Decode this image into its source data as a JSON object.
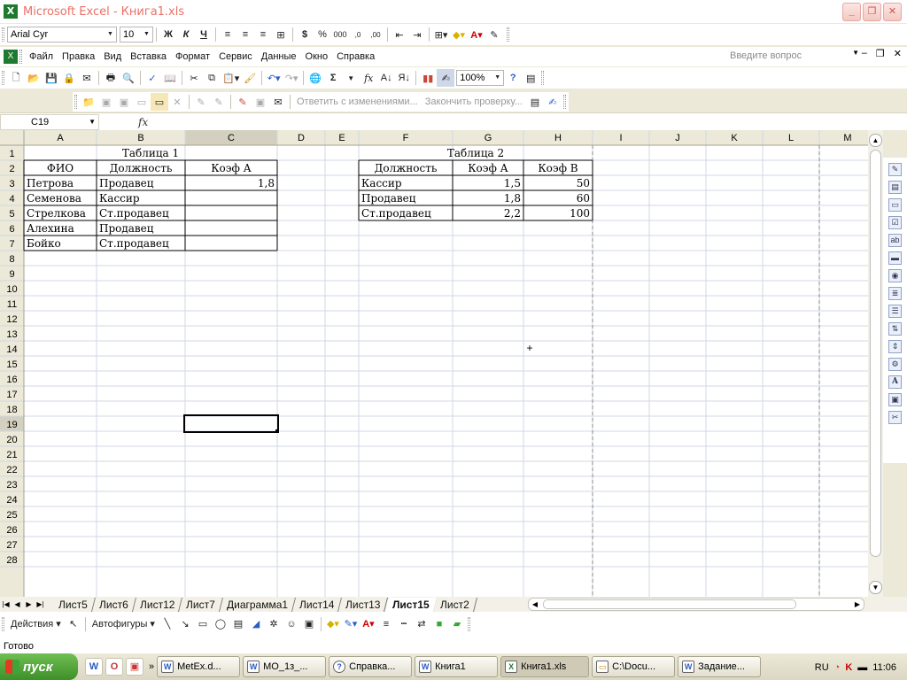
{
  "window": {
    "title": "Microsoft Excel - Книга1.xls"
  },
  "format_toolbar": {
    "font": "Arial Cyr",
    "size": "10",
    "bold": "Ж",
    "italic": "К",
    "underline": "Ч",
    "currency": "$",
    "percent": "%",
    "thousands": "000"
  },
  "menu": {
    "items": [
      "Файл",
      "Правка",
      "Вид",
      "Вставка",
      "Формат",
      "Сервис",
      "Данные",
      "Окно",
      "Справка"
    ],
    "help_placeholder": "Введите вопрос"
  },
  "standard_toolbar": {
    "zoom": "100%",
    "sum": "Σ",
    "fx": "fx"
  },
  "review_toolbar": {
    "reply": "Ответить с изменениями...",
    "end_review": "Закончить проверку..."
  },
  "formula_bar": {
    "name_box": "C19",
    "fx": "fx",
    "value": ""
  },
  "grid": {
    "columns": [
      "A",
      "B",
      "C",
      "D",
      "E",
      "F",
      "G",
      "H",
      "I",
      "J",
      "K",
      "L",
      "M"
    ],
    "rows": [
      "1",
      "2",
      "3",
      "4",
      "5",
      "6",
      "7",
      "8",
      "9",
      "10",
      "11",
      "12",
      "13",
      "14",
      "15",
      "16",
      "17",
      "18",
      "19",
      "20",
      "21",
      "22",
      "23",
      "24",
      "25",
      "26",
      "27",
      "28"
    ],
    "selected_cell": "C19",
    "selected_column": "C",
    "selected_row": "19"
  },
  "table1": {
    "caption": "Таблица 1",
    "headers": [
      "ФИО",
      "Должность",
      "Коэф А"
    ],
    "rows": [
      [
        "Петрова",
        "Продавец",
        "1,8"
      ],
      [
        "Семенова",
        "Кассир",
        ""
      ],
      [
        "Стрелкова",
        "Ст.продавец",
        ""
      ],
      [
        "Алехина",
        "Продавец",
        ""
      ],
      [
        "Бойко",
        "Ст.продавец",
        ""
      ]
    ]
  },
  "table2": {
    "caption": "Таблица 2",
    "headers": [
      "Должность",
      "Коэф А",
      "Коэф В"
    ],
    "rows": [
      [
        "Кассир",
        "1,5",
        "50"
      ],
      [
        "Продавец",
        "1,8",
        "60"
      ],
      [
        "Ст.продавец",
        "2,2",
        "100"
      ]
    ]
  },
  "sheet_tabs": {
    "tabs": [
      "Лист5",
      "Лист6",
      "Лист12",
      "Лист7",
      "Диаграмма1",
      "Лист14",
      "Лист13",
      "Лист15",
      "Лист2"
    ],
    "active": "Лист15"
  },
  "drawing_toolbar": {
    "actions": "Действия",
    "autoshapes": "Автофигуры"
  },
  "status": {
    "text": "Готово"
  },
  "taskbar": {
    "start": "пуск",
    "tasks": [
      "MetEx.d...",
      "MO_1з_...",
      "Справка...",
      "Книга1",
      "Книга1.xls",
      "C:\\Docu...",
      "Задание..."
    ],
    "active_task": "Книга1.xls",
    "lang": "RU",
    "clock": "11:06"
  },
  "colors": {
    "excel_green": "#1d7a2e",
    "title_red": "#ec6f66",
    "selection_header": "#d4d0bf",
    "grid_line": "#d0d7e5"
  }
}
